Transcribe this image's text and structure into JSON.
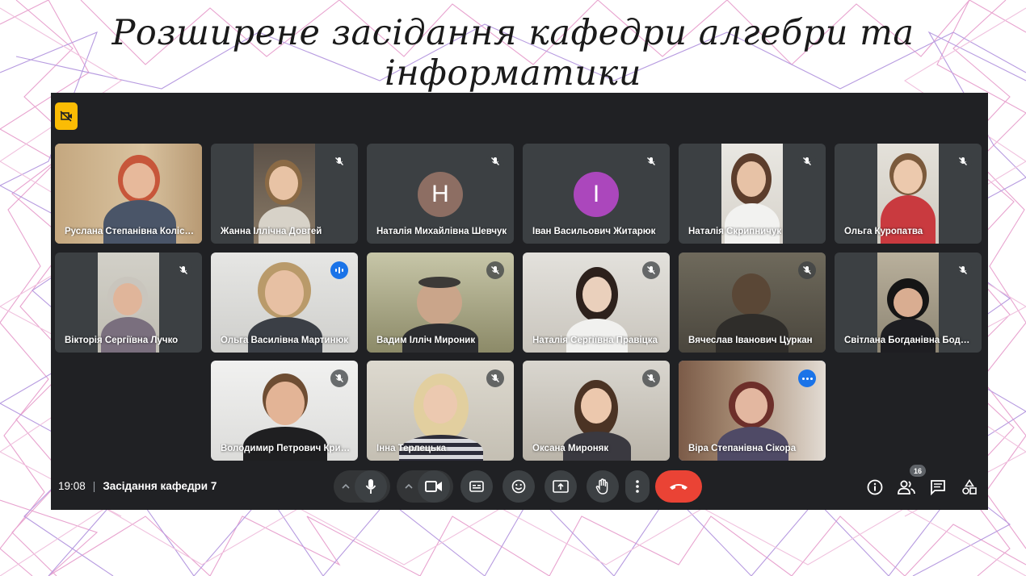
{
  "slide": {
    "title": "Розширене засідання кафедри алгебри та інформатики"
  },
  "meeting": {
    "time": "19:08",
    "separator": "|",
    "name": "Засідання кафедри 7",
    "participant_count": "16"
  },
  "tiles": [
    {
      "name": "Руслана Степанівна Колісник",
      "status": "none"
    },
    {
      "name": "Жанна Іллічна Довгей",
      "status": "muted"
    },
    {
      "name": "Наталія Михайлівна Шевчук",
      "status": "muted",
      "avatar_letter": "H",
      "avatar_color": "#8d6e63"
    },
    {
      "name": "Іван Васильович Житарюк",
      "status": "muted",
      "avatar_letter": "I",
      "avatar_color": "#ab47bc"
    },
    {
      "name": "Наталія Скрипничук",
      "status": "muted"
    },
    {
      "name": "Ольга Куропатва",
      "status": "muted"
    },
    {
      "name": "Вікторія Сергіївна Лучко",
      "status": "muted"
    },
    {
      "name": "Ольга Василівна Мартинюк",
      "status": "speaking"
    },
    {
      "name": "Вадим Ілліч Мироник",
      "status": "muted"
    },
    {
      "name": "Наталія Сергіївна Правіцка",
      "status": "muted"
    },
    {
      "name": "Вячеслав Іванович Цуркан",
      "status": "muted"
    },
    {
      "name": "Світлана Богданівна Боднарук",
      "status": "muted"
    },
    {
      "name": "Володимир Петрович Кривенко",
      "status": "muted"
    },
    {
      "name": "Інна Терлецька",
      "status": "muted"
    },
    {
      "name": "Оксана Мироняк",
      "status": "muted"
    },
    {
      "name": "Віра Степанівна Сікора",
      "status": "more-options"
    }
  ],
  "icons": {
    "no_camera": "camera-off-icon",
    "mic": "microphone-icon",
    "camera": "video-camera-icon",
    "captions": "closed-captions-icon",
    "emoji": "emoji-reaction-icon",
    "present": "present-screen-icon",
    "hand": "raise-hand-icon",
    "more": "more-options-icon",
    "end_call": "end-call-icon",
    "info": "info-icon",
    "people": "people-icon",
    "chat": "chat-icon",
    "activities": "activities-icon"
  },
  "colors": {
    "meet_bg": "#202124",
    "tile_bg": "#3c4043",
    "end_call": "#ea4335",
    "accent_blue": "#1a73e8",
    "badge_yellow": "#fbbc04",
    "pattern_pink": "#e8a3cf",
    "pattern_violet": "#b79be0"
  }
}
